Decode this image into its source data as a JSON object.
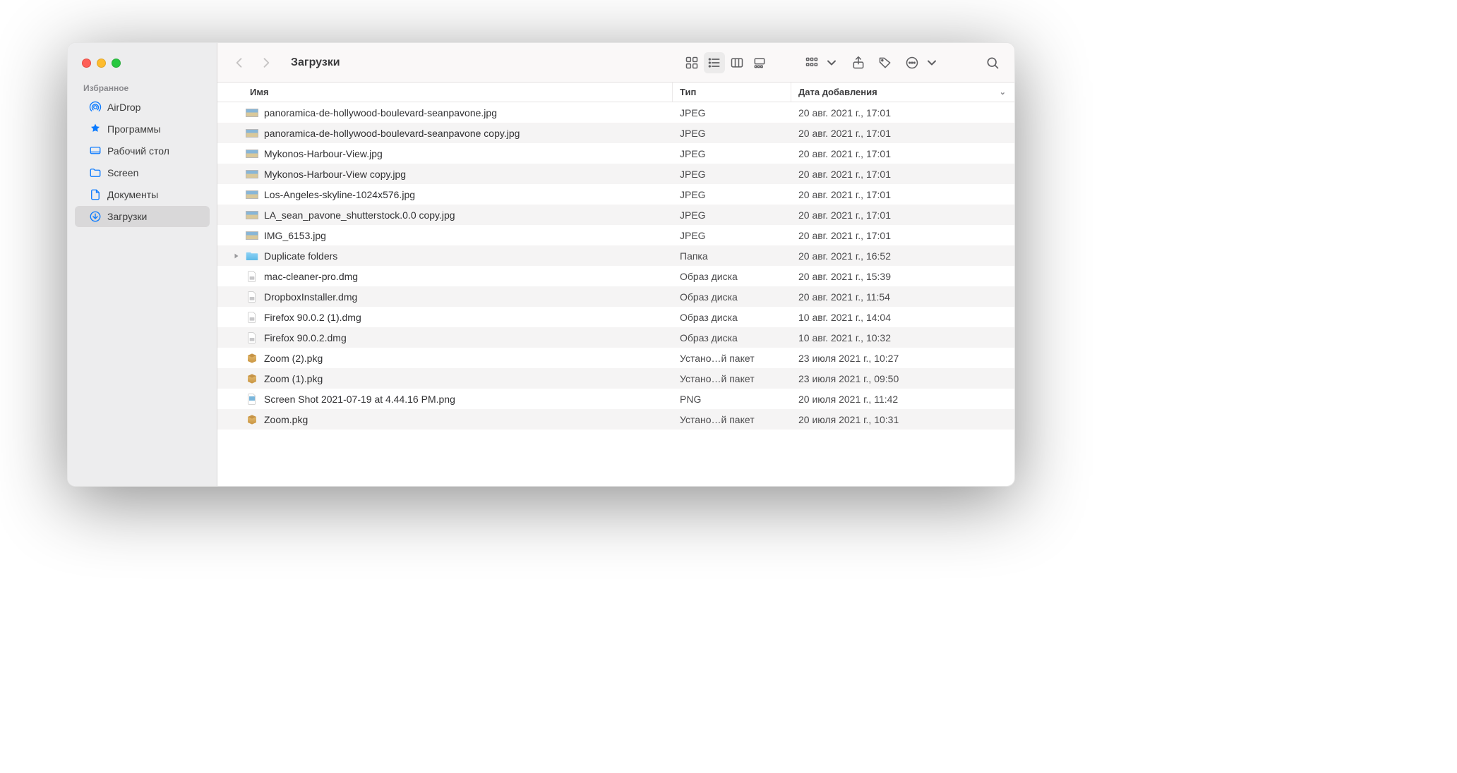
{
  "sidebar": {
    "section_label": "Избранное",
    "items": [
      {
        "label": "AirDrop",
        "icon": "airdrop"
      },
      {
        "label": "Программы",
        "icon": "apps"
      },
      {
        "label": "Рабочий стол",
        "icon": "desktop"
      },
      {
        "label": "Screen",
        "icon": "folder"
      },
      {
        "label": "Документы",
        "icon": "doc"
      },
      {
        "label": "Загрузки",
        "icon": "download",
        "active": true
      }
    ]
  },
  "toolbar": {
    "title": "Загрузки"
  },
  "columns": {
    "name": "Имя",
    "type": "Тип",
    "date": "Дата добавления"
  },
  "rows": [
    {
      "icon": "thumb",
      "name": "panoramica-de-hollywood-boulevard-seanpavone.jpg",
      "type": "JPEG",
      "date": "20 авг. 2021 г., 17:01"
    },
    {
      "icon": "thumb",
      "name": "panoramica-de-hollywood-boulevard-seanpavone copy.jpg",
      "type": "JPEG",
      "date": "20 авг. 2021 г., 17:01"
    },
    {
      "icon": "thumb",
      "name": "Mykonos-Harbour-View.jpg",
      "type": "JPEG",
      "date": "20 авг. 2021 г., 17:01"
    },
    {
      "icon": "thumb",
      "name": "Mykonos-Harbour-View copy.jpg",
      "type": "JPEG",
      "date": "20 авг. 2021 г., 17:01"
    },
    {
      "icon": "thumb",
      "name": "Los-Angeles-skyline-1024x576.jpg",
      "type": "JPEG",
      "date": "20 авг. 2021 г., 17:01"
    },
    {
      "icon": "thumb",
      "name": "LA_sean_pavone_shutterstock.0.0 copy.jpg",
      "type": "JPEG",
      "date": "20 авг. 2021 г., 17:01"
    },
    {
      "icon": "thumb",
      "name": "IMG_6153.jpg",
      "type": "JPEG",
      "date": "20 авг. 2021 г., 17:01"
    },
    {
      "icon": "folder",
      "name": "Duplicate folders",
      "type": "Папка",
      "date": "20 авг. 2021 г., 16:52",
      "folder": true
    },
    {
      "icon": "dmg",
      "name": "mac-cleaner-pro.dmg",
      "type": "Образ диска",
      "date": "20 авг. 2021 г., 15:39"
    },
    {
      "icon": "dmg",
      "name": "DropboxInstaller.dmg",
      "type": "Образ диска",
      "date": "20 авг. 2021 г., 11:54"
    },
    {
      "icon": "dmg",
      "name": "Firefox 90.0.2 (1).dmg",
      "type": "Образ диска",
      "date": "10 авг. 2021 г., 14:04"
    },
    {
      "icon": "dmg",
      "name": "Firefox 90.0.2.dmg",
      "type": "Образ диска",
      "date": "10 авг. 2021 г., 10:32"
    },
    {
      "icon": "pkg",
      "name": "Zoom (2).pkg",
      "type": "Устано…й пакет",
      "date": "23 июля 2021 г., 10:27"
    },
    {
      "icon": "pkg",
      "name": "Zoom (1).pkg",
      "type": "Устано…й пакет",
      "date": "23 июля 2021 г., 09:50"
    },
    {
      "icon": "png",
      "name": "Screen Shot 2021-07-19 at 4.44.16 PM.png",
      "type": "PNG",
      "date": "20 июля 2021 г., 11:42"
    },
    {
      "icon": "pkg",
      "name": "Zoom.pkg",
      "type": "Устано…й пакет",
      "date": "20 июля 2021 г., 10:31"
    }
  ]
}
